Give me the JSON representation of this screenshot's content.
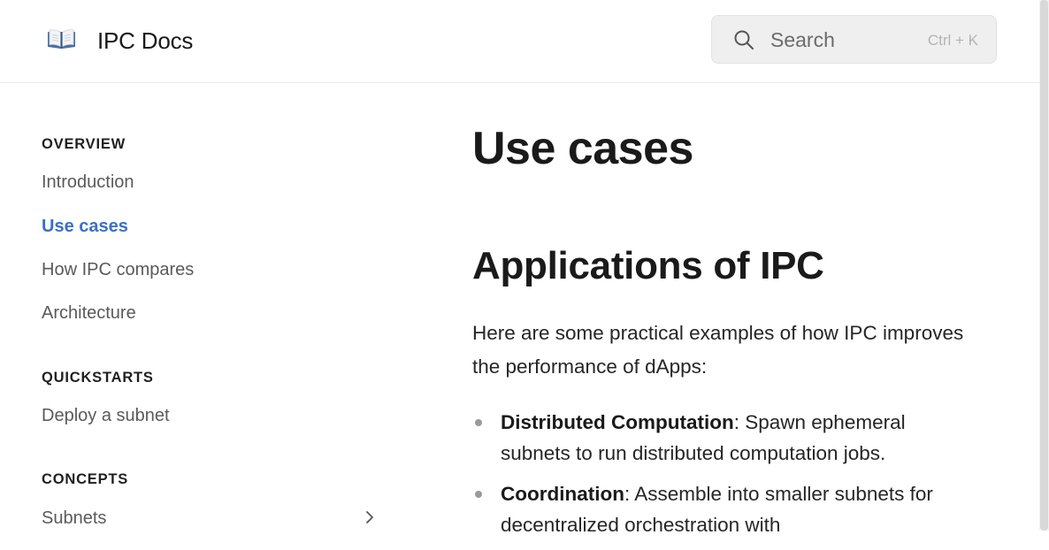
{
  "header": {
    "logo_icon": "open-book-icon",
    "site_title": "IPC Docs",
    "search": {
      "placeholder": "Search",
      "shortcut": "Ctrl + K",
      "icon": "search-icon"
    }
  },
  "sidebar": {
    "sections": [
      {
        "title": "OVERVIEW",
        "items": [
          {
            "label": "Introduction",
            "active": false
          },
          {
            "label": "Use cases",
            "active": true
          },
          {
            "label": "How IPC compares",
            "active": false
          },
          {
            "label": "Architecture",
            "active": false
          }
        ]
      },
      {
        "title": "QUICKSTARTS",
        "items": [
          {
            "label": "Deploy a subnet",
            "active": false
          }
        ]
      },
      {
        "title": "CONCEPTS",
        "items": [
          {
            "label": "Subnets",
            "active": false,
            "expandable": true
          }
        ]
      }
    ]
  },
  "main": {
    "title": "Use cases",
    "section_heading": "Applications of IPC",
    "intro": "Here are some practical examples of how IPC improves the performance of dApps:",
    "list": [
      {
        "term": "Distributed Computation",
        "text": ": Spawn ephemeral subnets to run distributed computation jobs."
      },
      {
        "term": "Coordination",
        "text": ": Assemble into smaller subnets for decentralized orchestration with"
      }
    ]
  },
  "colors": {
    "accent": "#3a6fcb",
    "text": "#1f1f1f",
    "muted_text": "#5a5a5a",
    "search_bg": "#efefef"
  }
}
